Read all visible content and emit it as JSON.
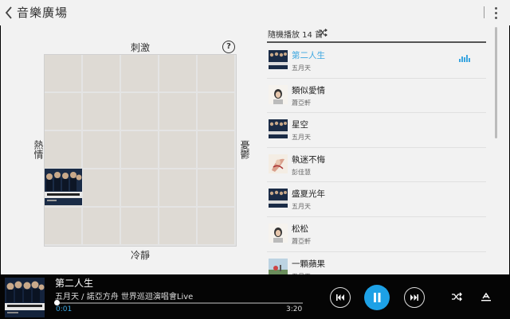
{
  "header": {
    "title": "音樂廣場"
  },
  "mood_grid": {
    "axis_top": "刺激",
    "axis_bottom": "冷靜",
    "axis_left": "熱情",
    "axis_right": "憂鬱",
    "help_label": "?"
  },
  "playlist": {
    "header": "隨機播放 14 首",
    "items": [
      {
        "song": "第二人生",
        "artist": "五月天",
        "art": "mayday",
        "active": true
      },
      {
        "song": "類似愛情",
        "artist": "蕭亞軒",
        "art": "face",
        "active": false
      },
      {
        "song": "星空",
        "artist": "五月天",
        "art": "mayday",
        "active": false
      },
      {
        "song": "執迷不悔",
        "artist": "彭佳慧",
        "art": "jolin",
        "active": false
      },
      {
        "song": "盛夏光年",
        "artist": "五月天",
        "art": "mayday",
        "active": false
      },
      {
        "song": "松松",
        "artist": "蕭亞軒",
        "art": "face",
        "active": false
      },
      {
        "song": "一顆蘋果",
        "artist": "五月天",
        "art": "green",
        "active": false
      }
    ]
  },
  "player": {
    "title": "第二人生",
    "subtitle": "五月天 / 諾亞方舟 世界巡迴演唱會Live",
    "time_current": "0:01",
    "time_total": "3:20",
    "progress": 0.005
  },
  "colors": {
    "accent": "#3ba6e0",
    "play_button": "#1da1e6",
    "player_bg": "#050505"
  }
}
